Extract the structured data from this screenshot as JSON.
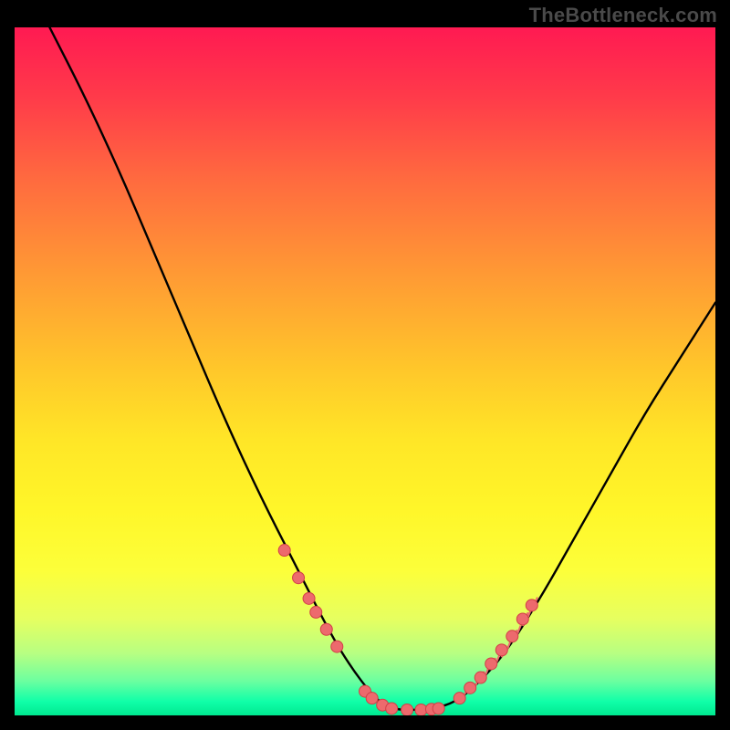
{
  "watermark": "TheBottleneck.com",
  "colors": {
    "background": "#000000",
    "curve_stroke": "#000000",
    "marker_fill": "#ed6a6d",
    "marker_stroke": "#d23f47",
    "gradient_top": "#ff1a52",
    "gradient_bottom": "#00e890",
    "watermark_text": "#4a4a4a"
  },
  "chart_data": {
    "type": "line",
    "title": "",
    "xlabel": "",
    "ylabel": "",
    "xlim": [
      0,
      100
    ],
    "ylim": [
      0,
      100
    ],
    "curve": {
      "name": "bottleneck-curve",
      "x": [
        5,
        10,
        15,
        20,
        25,
        30,
        35,
        40,
        45,
        48,
        51,
        53,
        55,
        57,
        60,
        63,
        66,
        70,
        75,
        80,
        85,
        90,
        95,
        100
      ],
      "y": [
        100,
        90,
        79,
        67,
        55,
        43,
        32,
        22,
        12,
        7,
        3,
        1.3,
        0.8,
        0.8,
        1.0,
        2.0,
        4.5,
        9,
        17,
        26,
        35,
        44,
        52,
        60
      ]
    },
    "markers": [
      {
        "x": 38.5,
        "y": 24
      },
      {
        "x": 40.5,
        "y": 20
      },
      {
        "x": 42.0,
        "y": 17
      },
      {
        "x": 43.0,
        "y": 15
      },
      {
        "x": 44.5,
        "y": 12.5
      },
      {
        "x": 46.0,
        "y": 10
      },
      {
        "x": 50.0,
        "y": 3.5
      },
      {
        "x": 51.0,
        "y": 2.5
      },
      {
        "x": 52.5,
        "y": 1.5
      },
      {
        "x": 53.8,
        "y": 1.0
      },
      {
        "x": 56.0,
        "y": 0.8
      },
      {
        "x": 58.0,
        "y": 0.8
      },
      {
        "x": 59.5,
        "y": 0.9
      },
      {
        "x": 60.5,
        "y": 1.0
      },
      {
        "x": 63.5,
        "y": 2.5
      },
      {
        "x": 65.0,
        "y": 4.0
      },
      {
        "x": 66.5,
        "y": 5.5
      },
      {
        "x": 68.0,
        "y": 7.5
      },
      {
        "x": 69.5,
        "y": 9.5
      },
      {
        "x": 71.0,
        "y": 11.5
      },
      {
        "x": 72.5,
        "y": 14.0
      },
      {
        "x": 73.8,
        "y": 16.0
      }
    ],
    "ticks": [
      {
        "x": 63.5,
        "len": 6
      },
      {
        "x": 64.2,
        "len": 7
      },
      {
        "x": 65.0,
        "len": 9
      },
      {
        "x": 65.8,
        "len": 8
      },
      {
        "x": 66.5,
        "len": 11
      },
      {
        "x": 67.2,
        "len": 9
      },
      {
        "x": 68.0,
        "len": 13
      },
      {
        "x": 68.7,
        "len": 10
      },
      {
        "x": 69.5,
        "len": 14
      },
      {
        "x": 70.2,
        "len": 11
      },
      {
        "x": 71.0,
        "len": 15
      },
      {
        "x": 71.7,
        "len": 11
      },
      {
        "x": 72.5,
        "len": 16
      },
      {
        "x": 73.2,
        "len": 12
      },
      {
        "x": 73.8,
        "len": 17
      }
    ],
    "background_gradient": "red→orange→yellow→green (vertical)"
  }
}
